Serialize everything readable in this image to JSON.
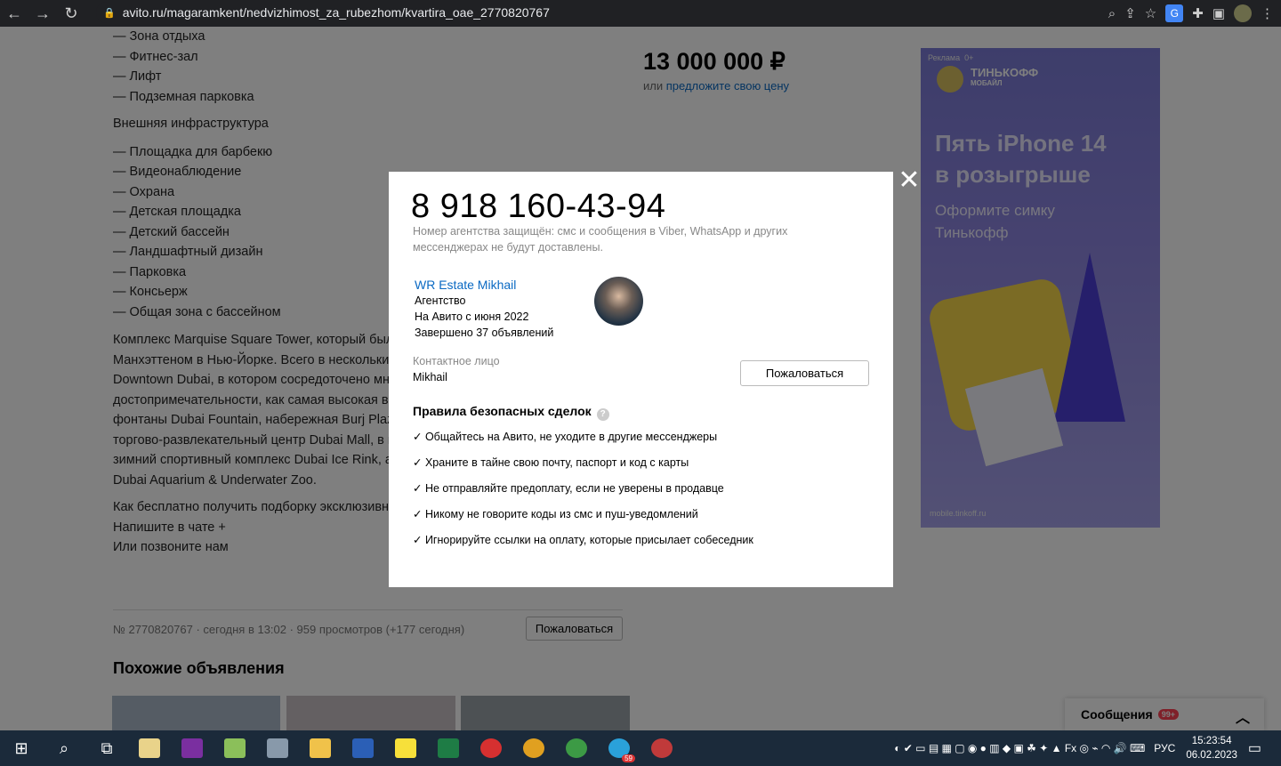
{
  "browser": {
    "url": "avito.ru/magaramkent/nedvizhimost_za_rubezhom/kvartira_oae_2770820767"
  },
  "listing": {
    "amenities": [
      "— Зона отдыха",
      "— Фитнес-зал",
      "— Лифт",
      "— Подземная парковка"
    ],
    "infra_heading": "Внешняя инфраструктура",
    "infra": [
      "— Площадка для барбекю",
      "— Видеонаблюдение",
      "— Охрана",
      "— Детская площадка",
      "— Детский бассейн",
      "— Ландшафтный дизайн",
      "— Парковка",
      "— Консьерж",
      "— Общая зона с бассейном"
    ],
    "desc_lines": [
      "Комплекс Marquise Square Tower, который был",
      "Манхэттеном в Нью-Йорке. Всего в нескольких",
      "Downtown Dubai, в котором сосредоточено мн",
      "достопримечательности, как самая высокая в",
      "фонтаны Dubai Fountain, набережная Burj Plaz",
      "торгово-развлекательный центр Dubai Mall, в н",
      "зимний спортивный комплекс Dubai Ice Rink, а",
      "Dubai Aquarium & Underwater Zoo."
    ],
    "cta_lines": [
      "Как бесплатно получить подборку эксклюзивн",
      "Напишите в чате +",
      "Или позвоните нам"
    ],
    "price": "13 000 000 ₽",
    "offer_prefix": "или",
    "offer_link": "предложите свою цену",
    "meta": "№ 2770820767 · сегодня в 13:02 · 959 просмотров (+177 сегодня)",
    "complain": "Пожаловаться",
    "similar_title": "Похожие объявления"
  },
  "ad": {
    "label": "Реклама",
    "age": "0+",
    "brand_line1": "ТИНЬКОФФ",
    "brand_line2": "МОБАЙЛ",
    "headline_1": "Пять iPhone 14",
    "headline_2": "в розыгрыше",
    "sub_1": "Оформите симку",
    "sub_2": "Тинькофф",
    "url": "mobile.tinkoff.ru"
  },
  "chat": {
    "label": "Сообщения",
    "badge": "99+"
  },
  "modal": {
    "phone": "8 918 160-43-94",
    "protect_text": "Номер агентства защищён: смс и сообщения в Viber, WhatsApp и других мессенджерах не будут доставлены.",
    "seller_name": "WR Estate Mikhail",
    "seller_type": "Агентство",
    "seller_since": "На Авито с июня 2022",
    "seller_done": "Завершено 37 объявлений",
    "contact_label": "Контактное лицо",
    "contact_name": "Mikhail",
    "complain": "Пожаловаться",
    "rules_title": "Правила безопасных сделок",
    "rules": [
      "✓ Общайтесь на Авито, не уходите в другие мессенджеры",
      "✓ Храните в тайне свою почту, паспорт и код с карты",
      "✓ Не отправляйте предоплату, если не уверены в продавце",
      "✓ Никому не говорите коды из смс и пуш-уведомлений",
      "✓ Игнорируйте ссылки на оплату, которые присылает собеседник"
    ]
  },
  "taskbar": {
    "lang": "РУС",
    "time": "15:23:54",
    "date": "06.02.2023",
    "telegram_badge": "59"
  },
  "colors": {
    "link": "#0a69c3",
    "taskbar": "#1b2a3a",
    "ad_bg": "#8d85e0"
  }
}
